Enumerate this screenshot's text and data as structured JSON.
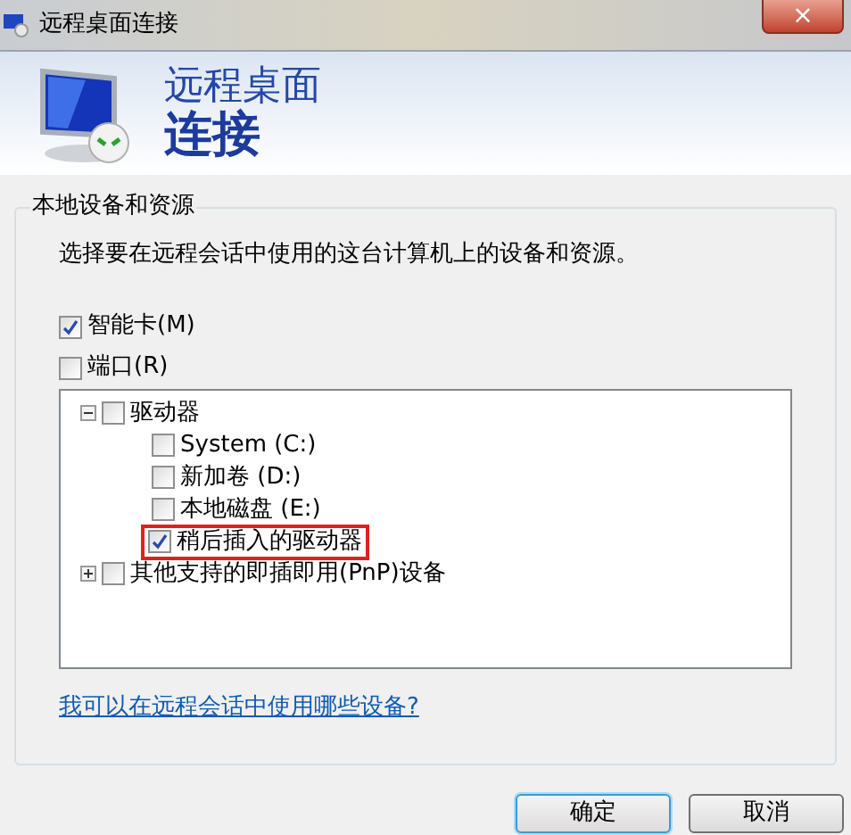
{
  "window": {
    "title": "远程桌面连接",
    "close": "×"
  },
  "header": {
    "line1": "远程桌面",
    "line2": "连接"
  },
  "group": {
    "legend": "本地设备和资源",
    "description": "选择要在远程会话中使用的这台计算机上的设备和资源。",
    "options": [
      {
        "label": "智能卡(M)",
        "checked": true
      },
      {
        "label": "端口(R)",
        "checked": false
      }
    ],
    "tree": [
      {
        "label": "驱动器",
        "checked": false,
        "expanded": true,
        "highlighted": false,
        "children": [
          {
            "label": "System (C:)",
            "checked": false,
            "highlighted": false
          },
          {
            "label": "新加卷 (D:)",
            "checked": false,
            "highlighted": false
          },
          {
            "label": "本地磁盘 (E:)",
            "checked": false,
            "highlighted": false
          },
          {
            "label": "稍后插入的驱动器",
            "checked": true,
            "highlighted": true
          }
        ]
      },
      {
        "label": "其他支持的即插即用(PnP)设备",
        "checked": false,
        "expanded": false,
        "highlighted": false
      }
    ],
    "link": "我可以在远程会话中使用哪些设备?"
  },
  "buttons": [
    {
      "label": "确定",
      "selected": true
    },
    {
      "label": "取消",
      "selected": false
    }
  ]
}
